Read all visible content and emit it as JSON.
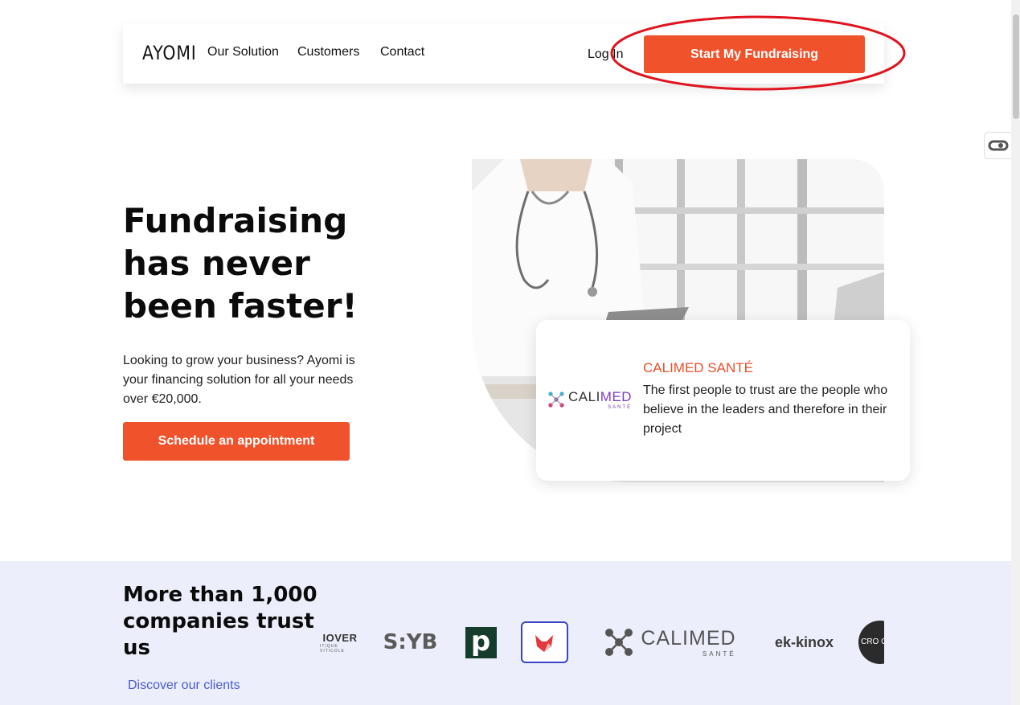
{
  "nav": {
    "logo": "AYOMI",
    "links": [
      "Our Solution",
      "Customers",
      "Contact"
    ],
    "login": "Log In",
    "cta": "Start My Fundraising"
  },
  "hero": {
    "title": "Fundraising has never been faster!",
    "text": "Looking to grow your business? Ayomi is your financing solution for all your needs over €20,000.",
    "cta": "Schedule an appointment"
  },
  "testimonial": {
    "logo_name_a": "CALI",
    "logo_name_b": "MED",
    "logo_sub": "SANTÉ",
    "title": "CALIMED SANTÉ",
    "text": "The first people to trust are the people who believe in the leaders and therefore in their project"
  },
  "clients": {
    "title": "More than 1,000 companies trust us",
    "link": "Discover our clients",
    "logos": [
      {
        "name": "IOVER",
        "sub": "ITIQUE VITICOLE"
      },
      {
        "name": "S:YB"
      },
      {
        "name": "p"
      },
      {
        "name": "fox-logo"
      },
      {
        "name_a": "CALIMED",
        "sub": "SANTÉ"
      },
      {
        "name": "ek-kinox"
      },
      {
        "name": "CRO COO"
      }
    ]
  },
  "colors": {
    "accent": "#f0522b",
    "band": "#eceffb",
    "link": "#4a5bd0",
    "annotation": "#e0141e"
  }
}
